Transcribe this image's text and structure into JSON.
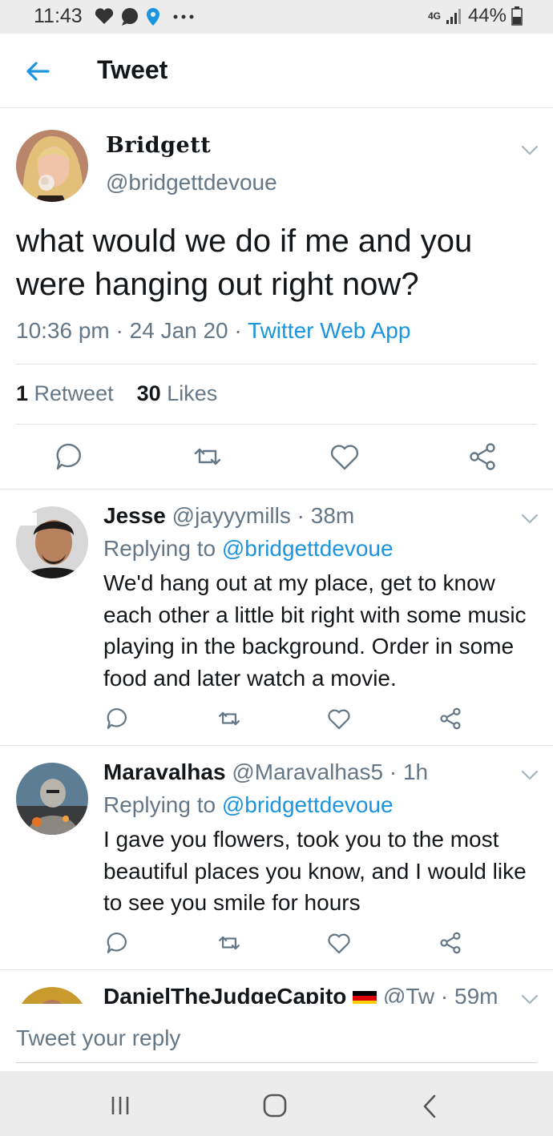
{
  "status_bar": {
    "time": "11:43",
    "network": "4G",
    "battery": "44%"
  },
  "header": {
    "title": "Tweet"
  },
  "tweet": {
    "display_name": "Bridgett",
    "handle": "@bridgettdevoue",
    "text": "what would we do if me and you were hanging out right now?",
    "time": "10:36 pm",
    "date": "24 Jan 20",
    "source": "Twitter Web App",
    "retweets_count": "1",
    "retweets_label": "Retweet",
    "likes_count": "30",
    "likes_label": "Likes"
  },
  "replies": [
    {
      "name": "Jesse",
      "handle": "@jayyymills",
      "age": "38m",
      "replying_label": "Replying to",
      "replying_to": "@bridgettdevoue",
      "text": "We'd hang out at my place, get to know each other a little bit right with some music playing in the background. Order in some food and later watch a movie."
    },
    {
      "name": "Maravalhas",
      "handle": "@Maravalhas5",
      "age": "1h",
      "replying_label": "Replying to",
      "replying_to": "@bridgettdevoue",
      "text": "I gave you flowers, took you to the most beautiful places you know, and I would like to see you smile for hours"
    },
    {
      "name": "DanielTheJudgeCapito",
      "handle": "@Tw",
      "age": "59m"
    }
  ],
  "composer": {
    "placeholder": "Tweet your reply"
  },
  "colors": {
    "accent": "#1b95e0",
    "text": "#14171a",
    "secondary": "#657786",
    "divider": "#dfe3e6"
  }
}
